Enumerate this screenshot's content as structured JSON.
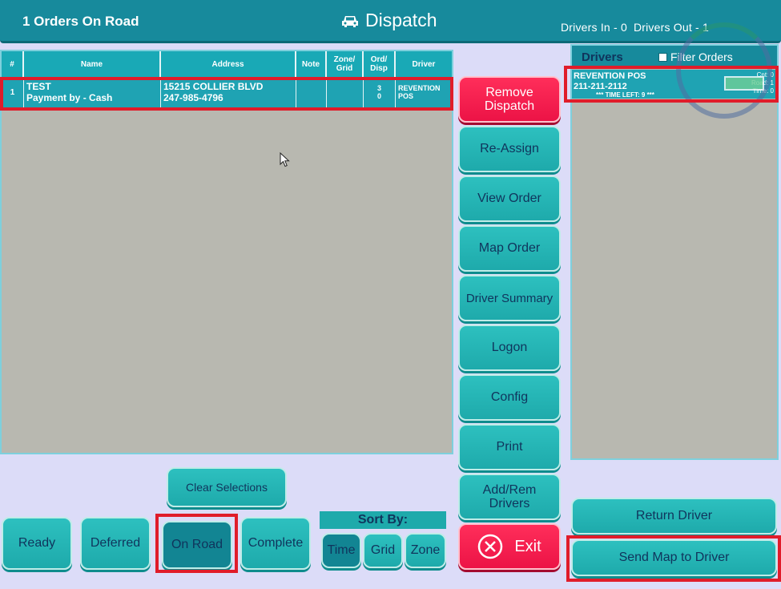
{
  "header": {
    "orders_on_road": "1 Orders On Road",
    "title": "Dispatch",
    "drivers_in": "Drivers In - 0",
    "drivers_out": "Drivers Out - 1"
  },
  "orders_table": {
    "columns": [
      "#",
      "Name",
      "Address",
      "Note",
      "Zone/ Grid",
      "Ord/ Disp",
      "Driver"
    ],
    "rows": [
      {
        "num": "1",
        "name_line1": "TEST",
        "name_line2": "Payment by - Cash",
        "address_line1": "15215 COLLIER BLVD",
        "address_line2": "247-985-4796",
        "note": "",
        "zone_grid": "",
        "ord_disp": "3\n0",
        "driver": "REVENTION POS"
      }
    ]
  },
  "middle_buttons": {
    "remove_dispatch": "Remove Dispatch",
    "reassign": "Re-Assign",
    "view_order": "View Order",
    "map_order": "Map Order",
    "driver_summary": "Driver Summary",
    "logon": "Logon",
    "config": "Config",
    "print": "Print",
    "add_rem_drivers": "Add/Rem Drivers",
    "exit": "Exit"
  },
  "drivers": {
    "title": "Drivers",
    "filter_label": "Filter Orders",
    "list": [
      {
        "name": "REVENTION POS",
        "phone": "211-211-2112",
        "time_left": "*** TIME LEFT: 9 ***",
        "cnt": "Cnt: 0",
        "road": "Road: 1",
        "time": "Time: 0"
      }
    ]
  },
  "bottom": {
    "clear_selections": "Clear Selections",
    "ready": "Ready",
    "deferred": "Deferred",
    "on_road": "On Road",
    "complete": "Complete",
    "sort_by": "Sort By:",
    "sort_time": "Time",
    "sort_grid": "Grid",
    "sort_zone": "Zone",
    "return_driver": "Return Driver",
    "send_map": "Send Map to Driver"
  },
  "colors": {
    "header": "#178a9c",
    "teal_button": "#1eaaab",
    "red_button": "#ec1346",
    "highlight": "#e01c2a"
  }
}
